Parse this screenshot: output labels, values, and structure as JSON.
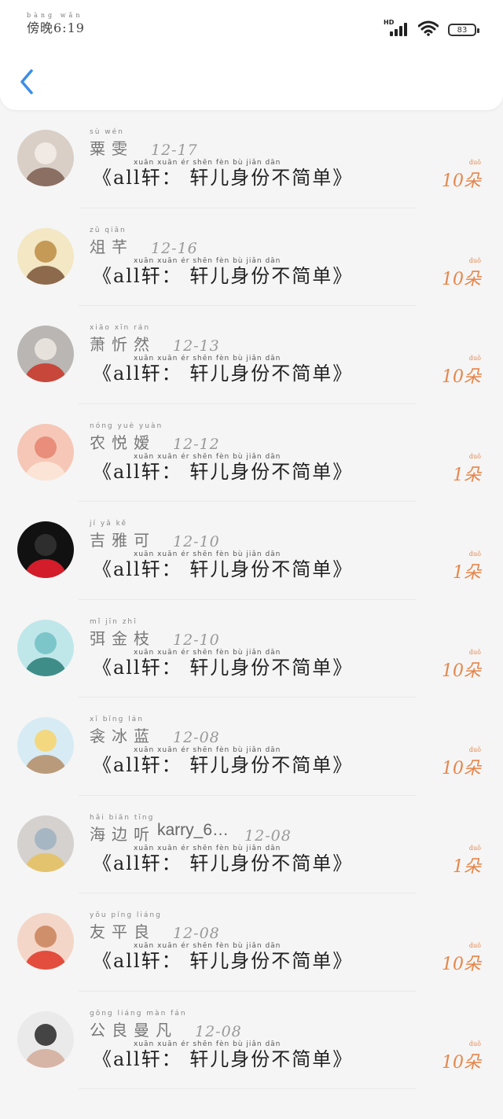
{
  "status_bar": {
    "time": "傍晚6:19",
    "time_pinyin": "bàng wǎn",
    "network": "HD",
    "battery": "83"
  },
  "title_pinyin": "xuān        xuān   ér   shēn  fèn   bù  jiǎn  dān",
  "title_text": "《all轩： 轩儿身份不简单》",
  "count_pinyin": "duǒ",
  "rows": [
    {
      "name": "粟雯",
      "pinyin": "sù wén",
      "extra": "",
      "date": "12-17",
      "count": "10朵"
    },
    {
      "name": "俎芊",
      "pinyin": "zǔ qiān",
      "extra": "",
      "date": "12-16",
      "count": "10朵"
    },
    {
      "name": "萧忻然",
      "pinyin": "xiāo xīn rán",
      "extra": "",
      "date": "12-13",
      "count": "10朵"
    },
    {
      "name": "农悦嫒",
      "pinyin": "nóng yuè yuàn",
      "extra": "",
      "date": "12-12",
      "count": "1朵"
    },
    {
      "name": "吉雅可",
      "pinyin": "jí yǎ kě",
      "extra": "",
      "date": "12-10",
      "count": "1朵"
    },
    {
      "name": "弭金枝",
      "pinyin": "mǐ jīn zhī",
      "extra": "",
      "date": "12-10",
      "count": "10朵"
    },
    {
      "name": "衾冰蓝",
      "pinyin": "xī bīng lán",
      "extra": "",
      "date": "12-08",
      "count": "10朵"
    },
    {
      "name": "海边听",
      "pinyin": "hǎi biān tīng",
      "extra": "karry_6…",
      "date": "12-08",
      "count": "1朵"
    },
    {
      "name": "友平良",
      "pinyin": "yǒu píng liáng",
      "extra": "",
      "date": "12-08",
      "count": "10朵"
    },
    {
      "name": "公良曼凡",
      "pinyin": "gōng liáng màn fán",
      "extra": "",
      "date": "12-08",
      "count": "10朵"
    }
  ],
  "colors": {
    "accent_blue": "#3b8ee8",
    "count_orange": "#e6864a"
  }
}
